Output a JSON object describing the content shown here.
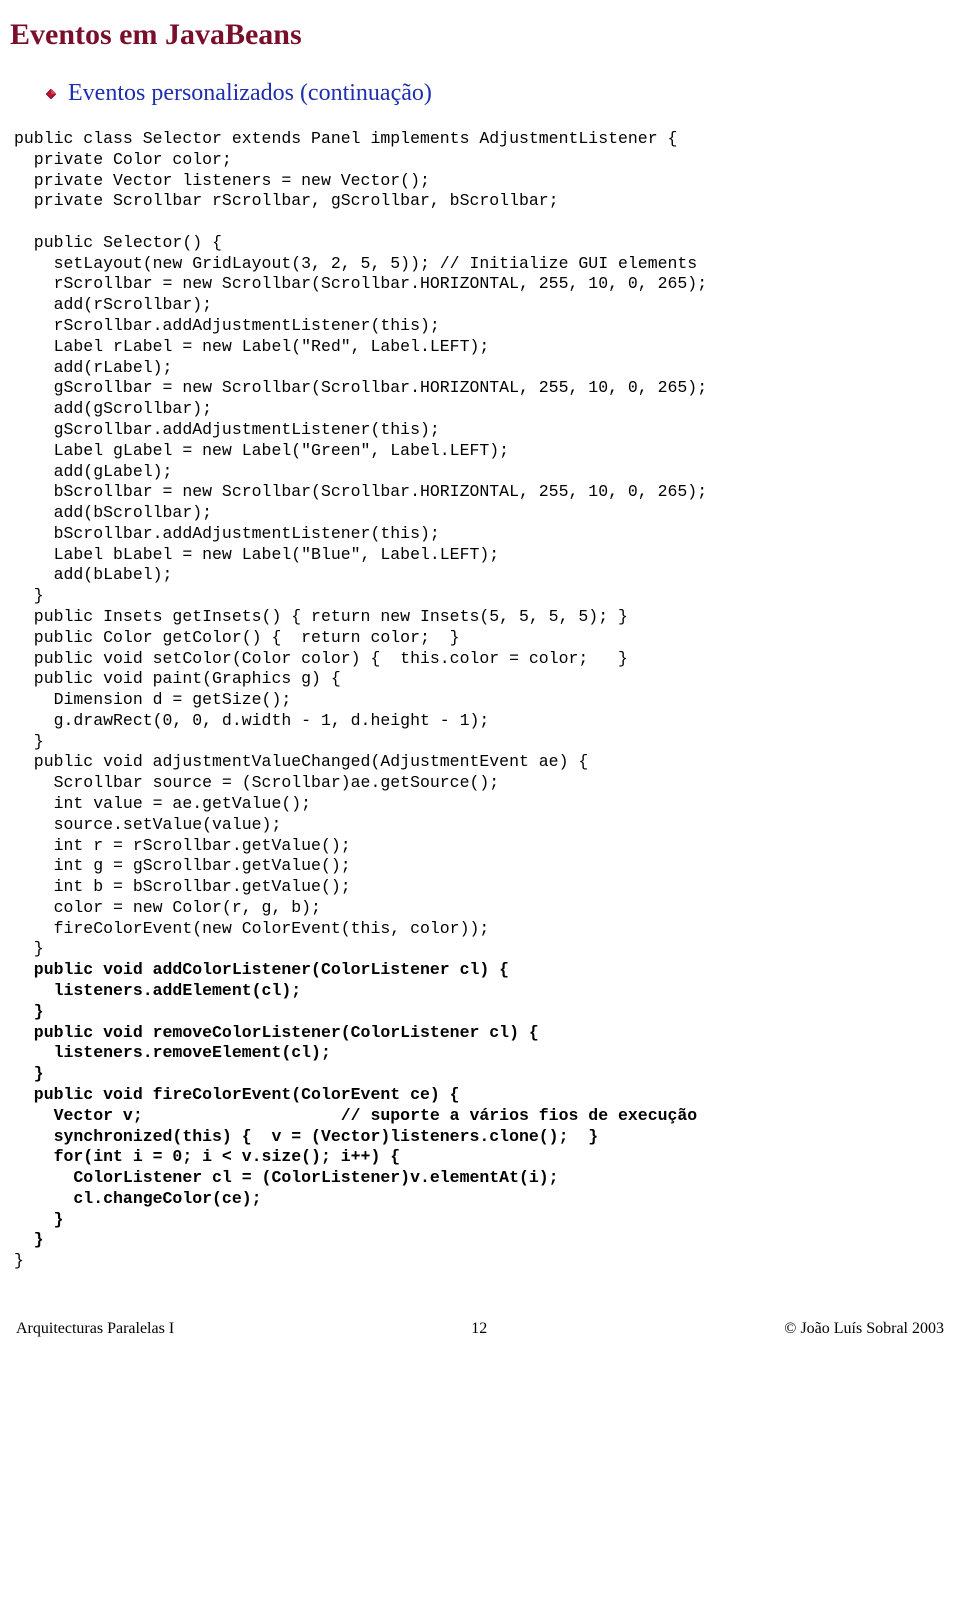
{
  "title": "Eventos em JavaBeans",
  "subtitle": "Eventos personalizados (continuação)",
  "code_lines": [
    {
      "indent": 0,
      "bold": false,
      "text": "public class Selector extends Panel implements AdjustmentListener {"
    },
    {
      "indent": 1,
      "bold": false,
      "text": "private Color color;"
    },
    {
      "indent": 1,
      "bold": false,
      "text": "private Vector listeners = new Vector();"
    },
    {
      "indent": 1,
      "bold": false,
      "text": "private Scrollbar rScrollbar, gScrollbar, bScrollbar;"
    },
    {
      "indent": 0,
      "bold": false,
      "text": ""
    },
    {
      "indent": 1,
      "bold": false,
      "text": "public Selector() {"
    },
    {
      "indent": 2,
      "bold": false,
      "text": "setLayout(new GridLayout(3, 2, 5, 5)); // Initialize GUI elements"
    },
    {
      "indent": 2,
      "bold": false,
      "text": "rScrollbar = new Scrollbar(Scrollbar.HORIZONTAL, 255, 10, 0, 265);"
    },
    {
      "indent": 2,
      "bold": false,
      "text": "add(rScrollbar);"
    },
    {
      "indent": 2,
      "bold": false,
      "text": "rScrollbar.addAdjustmentListener(this);"
    },
    {
      "indent": 2,
      "bold": false,
      "text": "Label rLabel = new Label(\"Red\", Label.LEFT);"
    },
    {
      "indent": 2,
      "bold": false,
      "text": "add(rLabel);"
    },
    {
      "indent": 2,
      "bold": false,
      "text": "gScrollbar = new Scrollbar(Scrollbar.HORIZONTAL, 255, 10, 0, 265);"
    },
    {
      "indent": 2,
      "bold": false,
      "text": "add(gScrollbar);"
    },
    {
      "indent": 2,
      "bold": false,
      "text": "gScrollbar.addAdjustmentListener(this);"
    },
    {
      "indent": 2,
      "bold": false,
      "text": "Label gLabel = new Label(\"Green\", Label.LEFT);"
    },
    {
      "indent": 2,
      "bold": false,
      "text": "add(gLabel);"
    },
    {
      "indent": 2,
      "bold": false,
      "text": "bScrollbar = new Scrollbar(Scrollbar.HORIZONTAL, 255, 10, 0, 265);"
    },
    {
      "indent": 2,
      "bold": false,
      "text": "add(bScrollbar);"
    },
    {
      "indent": 2,
      "bold": false,
      "text": "bScrollbar.addAdjustmentListener(this);"
    },
    {
      "indent": 2,
      "bold": false,
      "text": "Label bLabel = new Label(\"Blue\", Label.LEFT);"
    },
    {
      "indent": 2,
      "bold": false,
      "text": "add(bLabel);"
    },
    {
      "indent": 1,
      "bold": false,
      "text": "}"
    },
    {
      "indent": 1,
      "bold": false,
      "text": "public Insets getInsets() { return new Insets(5, 5, 5, 5); }"
    },
    {
      "indent": 1,
      "bold": false,
      "text": "public Color getColor() {  return color;  }"
    },
    {
      "indent": 1,
      "bold": false,
      "text": "public void setColor(Color color) {  this.color = color;   }"
    },
    {
      "indent": 1,
      "bold": false,
      "text": "public void paint(Graphics g) {"
    },
    {
      "indent": 2,
      "bold": false,
      "text": "Dimension d = getSize();"
    },
    {
      "indent": 2,
      "bold": false,
      "text": "g.drawRect(0, 0, d.width - 1, d.height - 1);"
    },
    {
      "indent": 1,
      "bold": false,
      "text": "}"
    },
    {
      "indent": 1,
      "bold": false,
      "text": "public void adjustmentValueChanged(AdjustmentEvent ae) {"
    },
    {
      "indent": 2,
      "bold": false,
      "text": "Scrollbar source = (Scrollbar)ae.getSource();"
    },
    {
      "indent": 2,
      "bold": false,
      "text": "int value = ae.getValue();"
    },
    {
      "indent": 2,
      "bold": false,
      "text": "source.setValue(value);"
    },
    {
      "indent": 2,
      "bold": false,
      "text": "int r = rScrollbar.getValue();"
    },
    {
      "indent": 2,
      "bold": false,
      "text": "int g = gScrollbar.getValue();"
    },
    {
      "indent": 2,
      "bold": false,
      "text": "int b = bScrollbar.getValue();"
    },
    {
      "indent": 2,
      "bold": false,
      "text": "color = new Color(r, g, b);"
    },
    {
      "indent": 2,
      "bold": false,
      "text": "fireColorEvent(new ColorEvent(this, color));"
    },
    {
      "indent": 1,
      "bold": false,
      "text": "}"
    },
    {
      "indent": 1,
      "bold": true,
      "text": "public void addColorListener(ColorListener cl) {"
    },
    {
      "indent": 2,
      "bold": true,
      "text": "listeners.addElement(cl);"
    },
    {
      "indent": 1,
      "bold": true,
      "text": "}"
    },
    {
      "indent": 1,
      "bold": true,
      "text": "public void removeColorListener(ColorListener cl) {"
    },
    {
      "indent": 2,
      "bold": true,
      "text": "listeners.removeElement(cl);"
    },
    {
      "indent": 1,
      "bold": true,
      "text": "}"
    },
    {
      "indent": 1,
      "bold": true,
      "text": "public void fireColorEvent(ColorEvent ce) {"
    },
    {
      "indent": 2,
      "bold": true,
      "text": "Vector v;                    // suporte a vários fios de execução"
    },
    {
      "indent": 2,
      "bold": true,
      "text": "synchronized(this) {  v = (Vector)listeners.clone();  }"
    },
    {
      "indent": 2,
      "bold": true,
      "text": "for(int i = 0; i < v.size(); i++) {"
    },
    {
      "indent": 3,
      "bold": true,
      "text": "ColorListener cl = (ColorListener)v.elementAt(i);"
    },
    {
      "indent": 3,
      "bold": true,
      "text": "cl.changeColor(ce);"
    },
    {
      "indent": 2,
      "bold": true,
      "text": "}"
    },
    {
      "indent": 1,
      "bold": true,
      "text": "}"
    },
    {
      "indent": 0,
      "bold": false,
      "text": "}"
    }
  ],
  "footer": {
    "left": "Arquitecturas Paralelas I",
    "center": "12",
    "right": "© João Luís Sobral 2003"
  }
}
